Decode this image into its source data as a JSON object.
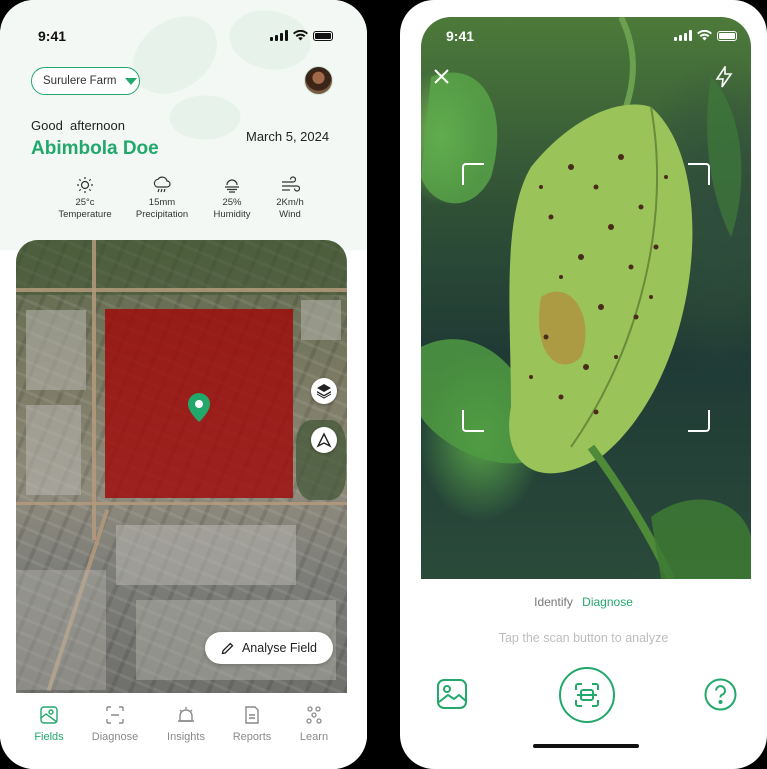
{
  "left": {
    "status": {
      "time": "9:41"
    },
    "farm_selector": {
      "label": "Surulere Farm"
    },
    "greeting": "Good  afternoon",
    "user_name": "Abimbola Doe",
    "date": "March 5, 2024",
    "weather": [
      {
        "icon": "sun-icon",
        "value": "25°c",
        "label": "Temperature"
      },
      {
        "icon": "cloud-rain-icon",
        "value": "15mm",
        "label": "Precipitation"
      },
      {
        "icon": "humidity-icon",
        "value": "25%",
        "label": "Humidity"
      },
      {
        "icon": "wind-icon",
        "value": "2Km/h",
        "label": "Wind"
      }
    ],
    "map": {
      "analyse_button": "Analyse Field"
    },
    "nav": [
      {
        "icon": "fields-icon",
        "label": "Fields",
        "active": true
      },
      {
        "icon": "diagnose-icon",
        "label": "Diagnose",
        "active": false
      },
      {
        "icon": "insights-icon",
        "label": "Insights",
        "active": false
      },
      {
        "icon": "reports-icon",
        "label": "Reports",
        "active": false
      },
      {
        "icon": "learn-icon",
        "label": "Learn",
        "active": false
      }
    ]
  },
  "right": {
    "status": {
      "time": "9:41"
    },
    "tabs": {
      "identify": "Identify",
      "diagnose": "Diagnose",
      "active": "Diagnose"
    },
    "hint": "Tap the scan button to analyze"
  },
  "colors": {
    "accent": "#23a86b",
    "field_overlay": "#a00a0a"
  }
}
